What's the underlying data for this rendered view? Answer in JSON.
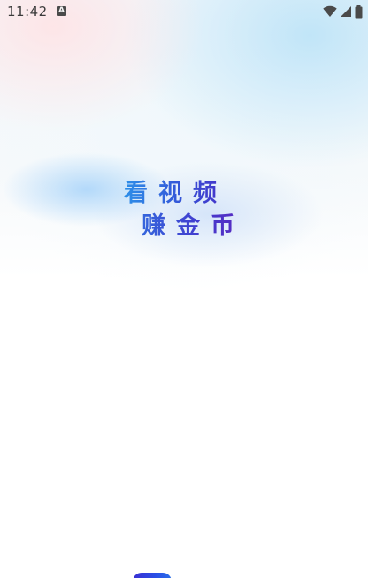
{
  "status_bar": {
    "time": "11:42",
    "notification_icon": "a-letter-icon",
    "notification_glyph": "A",
    "icons": [
      "wifi-icon",
      "signal-icon",
      "battery-icon"
    ]
  },
  "splash": {
    "slogan_line_1": "看视频",
    "slogan_line_2": "赚金币",
    "icon_glyph": "app-logo-icon"
  },
  "colors": {
    "slogan_start": "#2d8fe8",
    "slogan_end": "#5a28c0",
    "status_icons": "#4a4a4a",
    "logo_gradient_start": "#3a2fd2",
    "logo_gradient_end": "#2a6fe8"
  }
}
